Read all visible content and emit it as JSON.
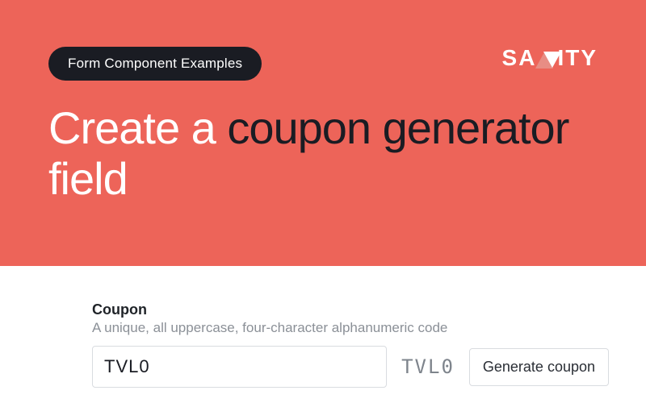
{
  "hero": {
    "pill_label": "Form Component Examples",
    "brand": "SANITY",
    "headline_parts": [
      {
        "text": "Create a ",
        "tone": "white"
      },
      {
        "text": "coupon generator",
        "tone": "dark"
      },
      {
        "text": " field",
        "tone": "white"
      }
    ]
  },
  "form": {
    "label": "Coupon",
    "description": "A unique, all uppercase, four-character alphanumeric code",
    "input_value": "TVL0",
    "preview_value": "TVL0",
    "generate_button_label": "Generate coupon"
  },
  "colors": {
    "hero_bg": "#ed6459",
    "dark": "#1a1c23"
  }
}
